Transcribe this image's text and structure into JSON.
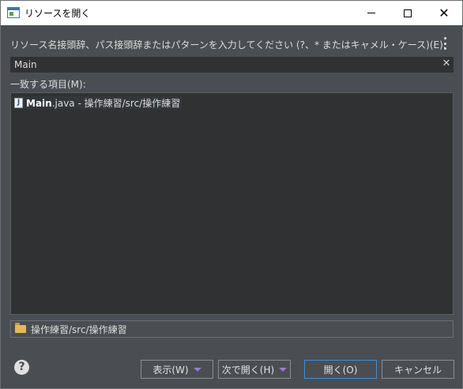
{
  "window": {
    "title": "リソースを開く",
    "minimize_glyph": "",
    "close_glyph": "✕"
  },
  "prompt": "リソース名接頭辞、パス接頭辞またはパターンを入力してください (?、* またはキャメル・ケース)(E):",
  "search": {
    "value": "Main",
    "clear_glyph": "✕"
  },
  "matches": {
    "label": "一致する項目(M):",
    "items": [
      {
        "icon": "java-file-icon",
        "icon_glyph": "J",
        "name": "Main",
        "ext": ".java",
        "location": " - 操作練習/src/操作練習"
      }
    ]
  },
  "selected_path": "操作練習/src/操作練習",
  "buttons": {
    "help": "?",
    "show": "表示(W)",
    "next_open": "次で開く(H)",
    "open": "開く(O)",
    "cancel": "キャンセル"
  },
  "colors": {
    "background": "#4a4e52",
    "list_background": "#2f3133",
    "primary_button_border": "#3f8fd6",
    "dropdown_caret": "#9a7ad6"
  }
}
